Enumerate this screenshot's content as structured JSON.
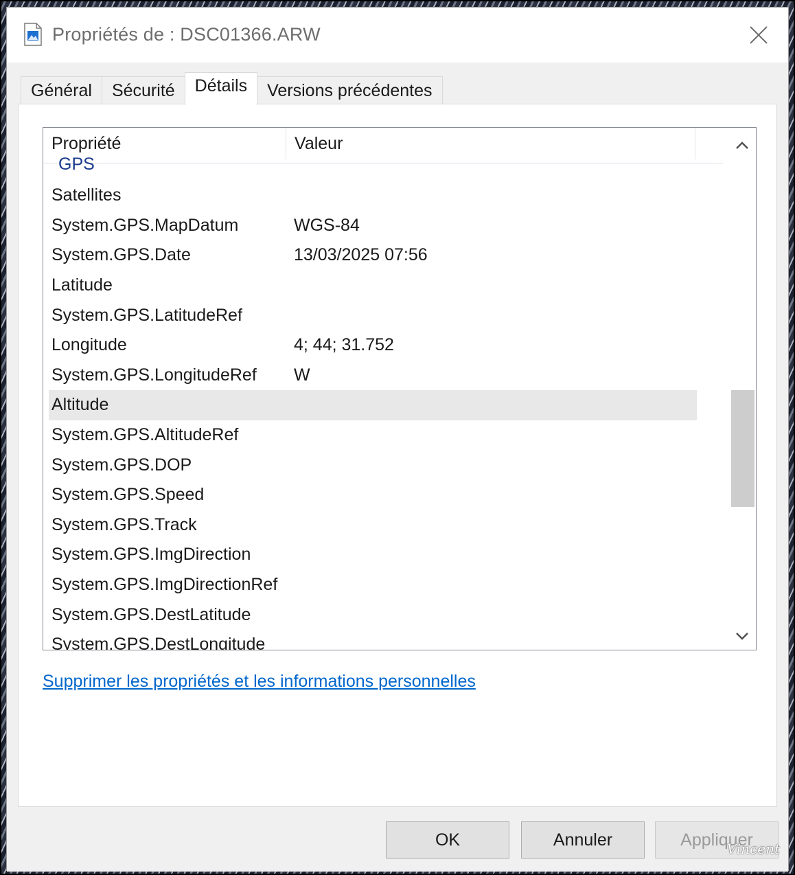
{
  "window": {
    "title": "Propriétés de : DSC01366.ARW",
    "icon": "image-file-icon",
    "close_icon": "close-icon"
  },
  "tabs": [
    {
      "label": "Général",
      "active": false
    },
    {
      "label": "Sécurité",
      "active": false
    },
    {
      "label": "Détails",
      "active": true
    },
    {
      "label": "Versions précédentes",
      "active": false
    }
  ],
  "listview": {
    "columns": [
      "Propriété",
      "Valeur"
    ],
    "group": "GPS",
    "rows": [
      {
        "name": "Satellites",
        "value": ""
      },
      {
        "name": "System.GPS.MapDatum",
        "value": "WGS-84"
      },
      {
        "name": "System.GPS.Date",
        "value": "13/03/2025 07:56"
      },
      {
        "name": "Latitude",
        "value": ""
      },
      {
        "name": "System.GPS.LatitudeRef",
        "value": ""
      },
      {
        "name": "Longitude",
        "value": "4; 44; 31.752"
      },
      {
        "name": "System.GPS.LongitudeRef",
        "value": "W"
      },
      {
        "name": "Altitude",
        "value": "",
        "selected": true
      },
      {
        "name": "System.GPS.AltitudeRef",
        "value": ""
      },
      {
        "name": "System.GPS.DOP",
        "value": ""
      },
      {
        "name": "System.GPS.Speed",
        "value": ""
      },
      {
        "name": "System.GPS.Track",
        "value": ""
      },
      {
        "name": "System.GPS.ImgDirection",
        "value": ""
      },
      {
        "name": "System.GPS.ImgDirectionRef",
        "value": ""
      },
      {
        "name": "System.GPS.DestLatitude",
        "value": ""
      },
      {
        "name": "System.GPS.DestLongitude",
        "value": ""
      }
    ]
  },
  "link": {
    "label": "Supprimer les propriétés et les informations personnelles"
  },
  "buttons": {
    "ok": "OK",
    "cancel": "Annuler",
    "apply": "Appliquer"
  },
  "watermark": "Vincent",
  "colors": {
    "link": "#0066cc",
    "group_label": "#1a3b8f",
    "selected_row": "#e8e8e8"
  }
}
